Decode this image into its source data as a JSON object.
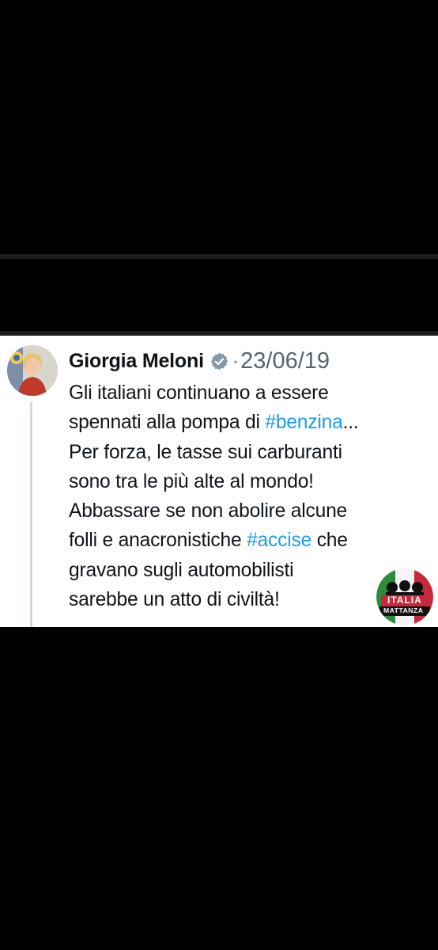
{
  "tweet": {
    "author": "Giorgia Meloni",
    "separator": "·",
    "date": "23/06/19",
    "lines": [
      [
        {
          "text": "Gli italiani continuano a essere",
          "hashtag": false
        }
      ],
      [
        {
          "text": "spennati alla pompa di ",
          "hashtag": false
        },
        {
          "text": "#benzina",
          "hashtag": true
        },
        {
          "text": "...",
          "hashtag": false
        }
      ],
      [
        {
          "text": "Per forza, le tasse sui carburanti",
          "hashtag": false
        }
      ],
      [
        {
          "text": "sono tra le più alte al mondo!",
          "hashtag": false
        }
      ],
      [
        {
          "text": "Abbassare se non abolire alcune",
          "hashtag": false
        }
      ],
      [
        {
          "text": "folli e anacronistiche ",
          "hashtag": false
        },
        {
          "text": "#accise",
          "hashtag": true
        },
        {
          "text": " che",
          "hashtag": false
        }
      ],
      [
        {
          "text": "gravano sugli automobilisti",
          "hashtag": false
        }
      ],
      [
        {
          "text": "sarebbe un atto di civiltà!",
          "hashtag": false
        }
      ]
    ],
    "hashtag_color": "#1d9bf0",
    "verified_icon": "verified-badge-icon"
  },
  "watermark": {
    "line1": "ITALIA",
    "line2": "MATTANZA"
  }
}
